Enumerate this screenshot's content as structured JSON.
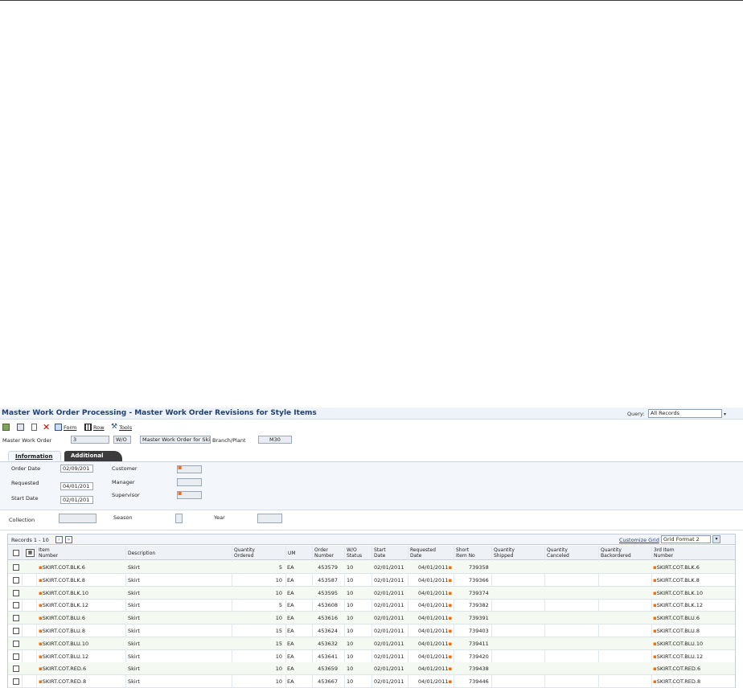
{
  "window": {
    "title": "Master Work Order Processing - Master Work Order Revisions for Style Items",
    "query_label": "Query:",
    "query_value": "All Records"
  },
  "toolbar": {
    "form_label": "Form",
    "row_label": "Row",
    "tools_label": "Tools"
  },
  "header": {
    "master_wo_label": "Master Work Order",
    "master_wo_value": "3",
    "wo_type": "W/O",
    "description": "Master Work Order for Ski",
    "branch_label": "Branch/Plant",
    "branch_value": "M30"
  },
  "tabs": [
    {
      "label": "Information"
    },
    {
      "label": "Additional"
    }
  ],
  "info": {
    "order_date_label": "Order Date",
    "order_date": "02/09/201",
    "requested_label": "Requested",
    "requested": "04/01/201",
    "start_date_label": "Start Date",
    "start_date": "02/01/201",
    "customer_label": "Customer",
    "manager_label": "Manager",
    "supervisor_label": "Supervisor",
    "collection_label": "Collection",
    "season_label": "Season",
    "year_label": "Year"
  },
  "grid": {
    "records_label": "Records 1 - 10",
    "customize_label": "Customize Grid",
    "format_value": "Grid Format 2",
    "columns": {
      "item1": "Item",
      "item2": "Number",
      "desc": "Description",
      "qty1": "Quantity",
      "qty2": "Ordered",
      "um": "UM",
      "ord1": "Order",
      "ord2": "Number",
      "wo1": "W/O",
      "wo2": "Status",
      "start1": "Start",
      "start2": "Date",
      "req1": "Requested",
      "req2": "Date",
      "short1": "Short",
      "short2": "Item No",
      "ship1": "Quantity",
      "ship2": "Shipped",
      "canc1": "Quantity",
      "canc2": "Canceled",
      "back1": "Quantity",
      "back2": "Backordered",
      "third1": "3rd Item",
      "third2": "Number"
    },
    "rows": [
      {
        "item": "SKIRT.COT.BLK.6",
        "desc": "Skirt",
        "qty": "5",
        "um": "EA",
        "order": "453579",
        "status": "10",
        "start": "02/01/2011",
        "req": "04/01/2011",
        "short": "739358",
        "third": "SKIRT.COT.BLK.6"
      },
      {
        "item": "SKIRT.COT.BLK.8",
        "desc": "Skirt",
        "qty": "10",
        "um": "EA",
        "order": "453587",
        "status": "10",
        "start": "02/01/2011",
        "req": "04/01/2011",
        "short": "739366",
        "third": "SKIRT.COT.BLK.8"
      },
      {
        "item": "SKIRT.COT.BLK.10",
        "desc": "Skirt",
        "qty": "10",
        "um": "EA",
        "order": "453595",
        "status": "10",
        "start": "02/01/2011",
        "req": "04/01/2011",
        "short": "739374",
        "third": "SKIRT.COT.BLK.10"
      },
      {
        "item": "SKIRT.COT.BLK.12",
        "desc": "Skirt",
        "qty": "5",
        "um": "EA",
        "order": "453608",
        "status": "10",
        "start": "02/01/2011",
        "req": "04/01/2011",
        "short": "739382",
        "third": "SKIRT.COT.BLK.12"
      },
      {
        "item": "SKIRT.COT.BLU.6",
        "desc": "Skirt",
        "qty": "10",
        "um": "EA",
        "order": "453616",
        "status": "10",
        "start": "02/01/2011",
        "req": "04/01/2011",
        "short": "739391",
        "third": "SKIRT.COT.BLU.6"
      },
      {
        "item": "SKIRT.COT.BLU.8",
        "desc": "Skirt",
        "qty": "15",
        "um": "EA",
        "order": "453624",
        "status": "10",
        "start": "02/01/2011",
        "req": "04/01/2011",
        "short": "739403",
        "third": "SKIRT.COT.BLU.8"
      },
      {
        "item": "SKIRT.COT.BLU.10",
        "desc": "Skirt",
        "qty": "15",
        "um": "EA",
        "order": "453632",
        "status": "10",
        "start": "02/01/2011",
        "req": "04/01/2011",
        "short": "739411",
        "third": "SKIRT.COT.BLU.10"
      },
      {
        "item": "SKIRT.COT.BLU.12",
        "desc": "Skirt",
        "qty": "10",
        "um": "EA",
        "order": "453641",
        "status": "10",
        "start": "02/01/2011",
        "req": "04/01/2011",
        "short": "739420",
        "third": "SKIRT.COT.BLU.12"
      },
      {
        "item": "SKIRT.COT.RED.6",
        "desc": "Skirt",
        "qty": "10",
        "um": "EA",
        "order": "453659",
        "status": "10",
        "start": "02/01/2011",
        "req": "04/01/2011",
        "short": "739438",
        "third": "SKIRT.COT.RED.6"
      },
      {
        "item": "SKIRT.COT.RED.8",
        "desc": "Skirt",
        "qty": "10",
        "um": "EA",
        "order": "453667",
        "status": "10",
        "start": "02/01/2011",
        "req": "04/01/2011",
        "short": "739446",
        "third": "SKIRT.COT.RED.8"
      }
    ]
  },
  "colors": {
    "title": "#1f3f73",
    "required_marker": "#ff6a00",
    "delete_icon": "#d00000",
    "row_alt": "#f4f9f1"
  },
  "icons": [
    "save-icon",
    "copy-icon",
    "delete-icon",
    "cancel-icon",
    "form-icon",
    "row-icon",
    "tools-icon"
  ]
}
